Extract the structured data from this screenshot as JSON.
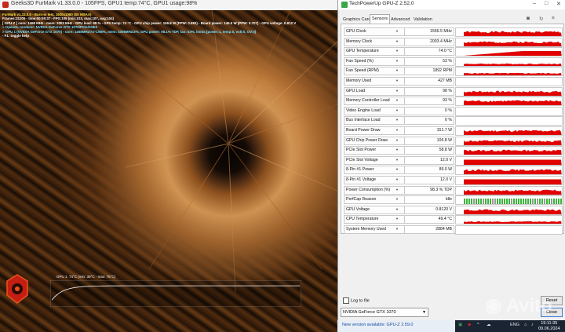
{
  "furmark": {
    "window_title": "Geeks3D FurMark v1.33.0.0 - 105FPS, GPU1 temp:74°C, GPU1 usage:98%",
    "overlay_lines": [
      {
        "text": "FurMark v1.33.0.0 - Burn-in test, 1920x1080 (8X MSAA)",
        "color": "c-yellow"
      },
      {
        "text": "Frames:31205 - time:00:05:37 - FPS:105 (min:103, max:107, avg:104)",
        "color": "c-white"
      },
      {
        "text": "[ GPU-Z ] core: 1468 MHz - mem: 2003 MHz - GPU load: 98 % - GPU temp: 74 °C - GPU chip power: 106.8 W (PPW: 0.983) - Board power: 146.0 W (PPW: 0.707) - GPU voltage: 0.812 V",
        "color": "c-white"
      },
      {
        "text": "> OpenGL renderer: NVIDIA GeForce GTX 1070/PCIe/SSE2",
        "color": "c-cyan"
      },
      {
        "text": "> GPU 1 (NVIDIA GeForce GTX 1070) - core: 1468MHz/74°C/98%, mem: 4006MHz/3%, GPU power: 98.1% TDP, fan: 53%, limits:[power:1, temp:0, volt:0, OV:0]",
        "color": "c-cyan"
      },
      {
        "text": "- F1: toggle help",
        "color": "c-white"
      }
    ],
    "graph_label": "GPU 1: 74°C (min: 39°C - max: 75°C)",
    "temp_curve": {
      "min": 39,
      "max": 75,
      "current": 74
    }
  },
  "gpuz": {
    "window_title": "TechPowerUp GPU-Z 2.52.0",
    "tabs": [
      "Graphics Card",
      "Sensors",
      "Advanced",
      "Validation"
    ],
    "active_tab": "Sensors",
    "sensors": [
      {
        "label": "GPU Clock",
        "value": "1556.5 MHz",
        "graph": "busy"
      },
      {
        "label": "Memory Clock",
        "value": "2003.4 MHz",
        "graph": "busy"
      },
      {
        "label": "GPU Temperature",
        "value": "74.0 °C",
        "graph": "temp"
      },
      {
        "label": "Fan Speed (%)",
        "value": "53 %",
        "graph": "mid"
      },
      {
        "label": "Fan Speed (RPM)",
        "value": "1892 RPM",
        "graph": "mid"
      },
      {
        "label": "Memory Used",
        "value": "427 MB",
        "graph": "low"
      },
      {
        "label": "GPU Load",
        "value": "98 %",
        "graph": "busy"
      },
      {
        "label": "Memory Controller Load",
        "value": "93 %",
        "graph": "busy"
      },
      {
        "label": "Video Engine Load",
        "value": "0 %",
        "graph": "none"
      },
      {
        "label": "Bus Interface Load",
        "value": "0 %",
        "graph": "none"
      },
      {
        "label": "Board Power Draw",
        "value": "151.7 W",
        "graph": "busy"
      },
      {
        "label": "GPU Chip Power Draw",
        "value": "106.8 W",
        "graph": "busy"
      },
      {
        "label": "PCIe Slot Power",
        "value": "58.8 W",
        "graph": "busy"
      },
      {
        "label": "PCIe Slot Voltage",
        "value": "12.0 V",
        "graph": "full"
      },
      {
        "label": "8-Pin #1 Power",
        "value": "89.0 W",
        "graph": "busy"
      },
      {
        "label": "8-Pin #1 Voltage",
        "value": "12.0 V",
        "graph": "full"
      },
      {
        "label": "Power Consumption (%)",
        "value": "98.3 % TDP",
        "graph": "busy"
      },
      {
        "label": "PerfCap Reason",
        "value": "Idle",
        "graph": "perfcap"
      },
      {
        "label": "GPU Voltage",
        "value": "0.8120 V",
        "graph": "busy"
      },
      {
        "label": "CPU Temperature",
        "value": "49.4 °C",
        "graph": "mid"
      },
      {
        "label": "System Memory Used",
        "value": "2884 MB",
        "graph": "low"
      }
    ],
    "log_to_file_label": "Log to file",
    "reset_label": "Reset",
    "close_label": "Close",
    "gpu_select_value": "NVIDIA GeForce GTX 1070",
    "notify_text": "New version available: GPU-Z 2.59.0",
    "accent_color": "#e00000",
    "perfcap_color": "#3bb53b"
  },
  "taskbar": {
    "language": "ENG",
    "time": "19:11:35",
    "date": "09.06.2024"
  },
  "watermark": "Avito"
}
